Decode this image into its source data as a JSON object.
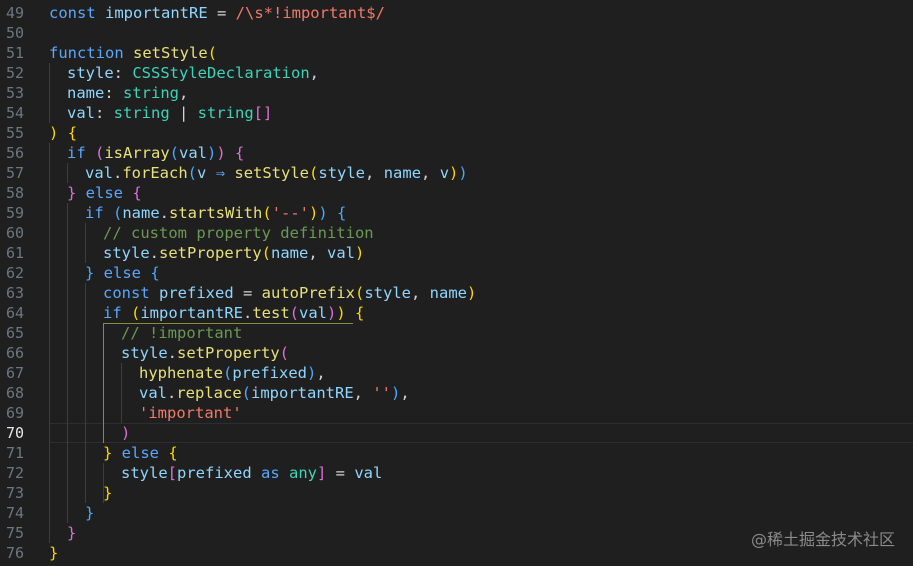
{
  "editor": {
    "active_line": 70,
    "watermark": "@稀土掘金技术社区",
    "lines": [
      {
        "num": 49,
        "indent": 0,
        "tokens": [
          [
            "kw",
            "const "
          ],
          [
            "id",
            "importantRE"
          ],
          [
            "op",
            " = "
          ],
          [
            "st",
            "/\\s*!important$/"
          ]
        ]
      },
      {
        "num": 50,
        "indent": 0,
        "tokens": []
      },
      {
        "num": 51,
        "indent": 0,
        "tokens": [
          [
            "kw",
            "function "
          ],
          [
            "fn",
            "setStyle"
          ],
          [
            "b1",
            "("
          ]
        ]
      },
      {
        "num": 52,
        "indent": 1,
        "tokens": [
          [
            "id",
            "style"
          ],
          [
            "op",
            ": "
          ],
          [
            "ty",
            "CSSStyleDeclaration"
          ],
          [
            "op",
            ","
          ]
        ]
      },
      {
        "num": 53,
        "indent": 1,
        "tokens": [
          [
            "id",
            "name"
          ],
          [
            "op",
            ": "
          ],
          [
            "ty",
            "string"
          ],
          [
            "op",
            ","
          ]
        ]
      },
      {
        "num": 54,
        "indent": 1,
        "tokens": [
          [
            "id",
            "val"
          ],
          [
            "op",
            ": "
          ],
          [
            "ty",
            "string"
          ],
          [
            "op",
            " | "
          ],
          [
            "ty",
            "string"
          ],
          [
            "b2",
            "[]"
          ]
        ]
      },
      {
        "num": 55,
        "indent": 0,
        "tokens": [
          [
            "b1",
            ")"
          ],
          [
            "op",
            " "
          ],
          [
            "b1",
            "{"
          ]
        ]
      },
      {
        "num": 56,
        "indent": 1,
        "tokens": [
          [
            "kw",
            "if "
          ],
          [
            "b2",
            "("
          ],
          [
            "fn",
            "isArray"
          ],
          [
            "b3",
            "("
          ],
          [
            "id",
            "val"
          ],
          [
            "b3",
            ")"
          ],
          [
            "b2",
            ")"
          ],
          [
            "op",
            " "
          ],
          [
            "b2",
            "{"
          ]
        ]
      },
      {
        "num": 57,
        "indent": 2,
        "tokens": [
          [
            "id",
            "val"
          ],
          [
            "op",
            "."
          ],
          [
            "fn",
            "forEach"
          ],
          [
            "b3",
            "("
          ],
          [
            "id",
            "v"
          ],
          [
            "kw",
            " ⇒ "
          ],
          [
            "fn",
            "setStyle"
          ],
          [
            "b1",
            "("
          ],
          [
            "id",
            "style"
          ],
          [
            "op",
            ", "
          ],
          [
            "id",
            "name"
          ],
          [
            "op",
            ", "
          ],
          [
            "id",
            "v"
          ],
          [
            "b1",
            ")"
          ],
          [
            "b3",
            ")"
          ]
        ]
      },
      {
        "num": 58,
        "indent": 1,
        "tokens": [
          [
            "b2",
            "}"
          ],
          [
            "kw",
            " else "
          ],
          [
            "b2",
            "{"
          ]
        ]
      },
      {
        "num": 59,
        "indent": 2,
        "tokens": [
          [
            "kw",
            "if "
          ],
          [
            "b3",
            "("
          ],
          [
            "id",
            "name"
          ],
          [
            "op",
            "."
          ],
          [
            "fn",
            "startsWith"
          ],
          [
            "b1",
            "("
          ],
          [
            "st",
            "'--'"
          ],
          [
            "b1",
            ")"
          ],
          [
            "b3",
            ")"
          ],
          [
            "op",
            " "
          ],
          [
            "b3",
            "{"
          ]
        ]
      },
      {
        "num": 60,
        "indent": 3,
        "tokens": [
          [
            "cm",
            "// custom property definition"
          ]
        ]
      },
      {
        "num": 61,
        "indent": 3,
        "tokens": [
          [
            "id",
            "style"
          ],
          [
            "op",
            "."
          ],
          [
            "fn",
            "setProperty"
          ],
          [
            "b1",
            "("
          ],
          [
            "id",
            "name"
          ],
          [
            "op",
            ", "
          ],
          [
            "id",
            "val"
          ],
          [
            "b1",
            ")"
          ]
        ]
      },
      {
        "num": 62,
        "indent": 2,
        "tokens": [
          [
            "b3",
            "}"
          ],
          [
            "kw",
            " else "
          ],
          [
            "b3",
            "{"
          ]
        ]
      },
      {
        "num": 63,
        "indent": 3,
        "tokens": [
          [
            "kw",
            "const "
          ],
          [
            "id",
            "prefixed"
          ],
          [
            "op",
            " = "
          ],
          [
            "fn",
            "autoPrefix"
          ],
          [
            "b1",
            "("
          ],
          [
            "id",
            "style"
          ],
          [
            "op",
            ", "
          ],
          [
            "id",
            "name"
          ],
          [
            "b1",
            ")"
          ]
        ]
      },
      {
        "num": 64,
        "indent": 3,
        "tokens": [
          [
            "kw",
            "if "
          ],
          [
            "b1",
            "("
          ],
          [
            "id",
            "importantRE"
          ],
          [
            "op",
            "."
          ],
          [
            "fn",
            "test"
          ],
          [
            "b2",
            "("
          ],
          [
            "id",
            "val"
          ],
          [
            "b2",
            ")"
          ],
          [
            "b1",
            ")"
          ],
          [
            "op",
            " "
          ],
          [
            "b1",
            "{"
          ]
        ]
      },
      {
        "num": 65,
        "indent": 4,
        "tokens": [
          [
            "cm",
            "// !important"
          ]
        ]
      },
      {
        "num": 66,
        "indent": 4,
        "tokens": [
          [
            "id",
            "style"
          ],
          [
            "op",
            "."
          ],
          [
            "fn",
            "setProperty"
          ],
          [
            "b2",
            "("
          ]
        ]
      },
      {
        "num": 67,
        "indent": 5,
        "tokens": [
          [
            "fn",
            "hyphenate"
          ],
          [
            "b3",
            "("
          ],
          [
            "id",
            "prefixed"
          ],
          [
            "b3",
            ")"
          ],
          [
            "op",
            ","
          ]
        ]
      },
      {
        "num": 68,
        "indent": 5,
        "tokens": [
          [
            "id",
            "val"
          ],
          [
            "op",
            "."
          ],
          [
            "fn",
            "replace"
          ],
          [
            "b3",
            "("
          ],
          [
            "id",
            "importantRE"
          ],
          [
            "op",
            ", "
          ],
          [
            "st",
            "''"
          ],
          [
            "b3",
            ")"
          ],
          [
            "op",
            ","
          ]
        ]
      },
      {
        "num": 69,
        "indent": 5,
        "tokens": [
          [
            "st",
            "'important'"
          ]
        ]
      },
      {
        "num": 70,
        "indent": 4,
        "tokens": [
          [
            "b2",
            ")"
          ]
        ]
      },
      {
        "num": 71,
        "indent": 3,
        "tokens": [
          [
            "b1",
            "}"
          ],
          [
            "kw",
            " else "
          ],
          [
            "b1",
            "{"
          ]
        ]
      },
      {
        "num": 72,
        "indent": 4,
        "tokens": [
          [
            "id",
            "style"
          ],
          [
            "b2",
            "["
          ],
          [
            "id",
            "prefixed"
          ],
          [
            "kw",
            " as "
          ],
          [
            "ty",
            "any"
          ],
          [
            "b2",
            "]"
          ],
          [
            "op",
            " = "
          ],
          [
            "id",
            "val"
          ]
        ]
      },
      {
        "num": 73,
        "indent": 3,
        "tokens": [
          [
            "b1",
            "}"
          ]
        ]
      },
      {
        "num": 74,
        "indent": 2,
        "tokens": [
          [
            "b3",
            "}"
          ]
        ]
      },
      {
        "num": 75,
        "indent": 1,
        "tokens": [
          [
            "b2",
            "}"
          ]
        ]
      },
      {
        "num": 76,
        "indent": 0,
        "tokens": [
          [
            "b1",
            "}"
          ]
        ]
      }
    ]
  }
}
